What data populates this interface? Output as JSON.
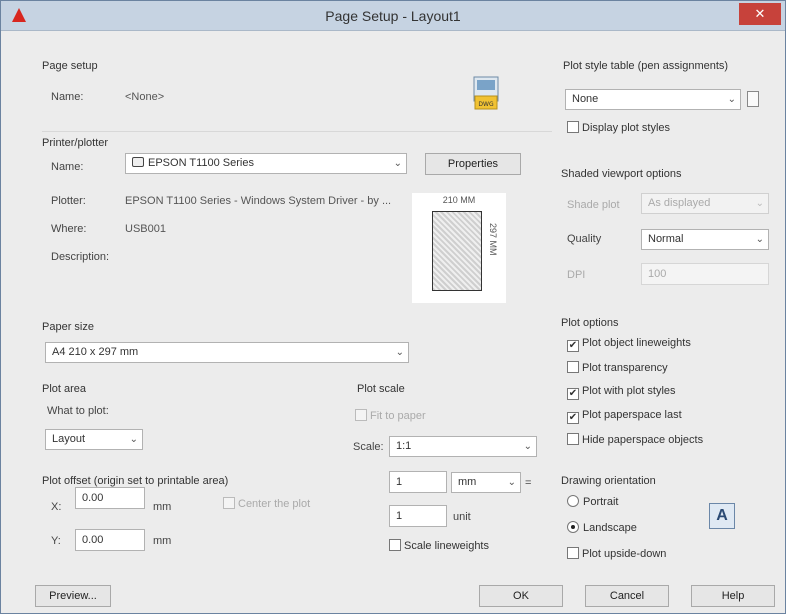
{
  "window": {
    "title": "Page Setup - Layout1",
    "close_glyph": "✕"
  },
  "page_setup": {
    "title": "Page setup",
    "name_label": "Name:",
    "name_value": "<None>"
  },
  "printer": {
    "title": "Printer/plotter",
    "name_label": "Name:",
    "name_value": "EPSON T1100 Series",
    "properties_button": "Properties",
    "plotter_label": "Plotter:",
    "plotter_value": "EPSON T1100 Series - Windows System Driver - by ...",
    "where_label": "Where:",
    "where_value": "USB001",
    "description_label": "Description:",
    "preview_width": "210 MM",
    "preview_height": "297 MM"
  },
  "paper_size": {
    "title": "Paper size",
    "value": "A4 210 x 297 mm"
  },
  "plot_area": {
    "title": "Plot area",
    "what_label": "What to plot:",
    "what_value": "Layout"
  },
  "plot_offset": {
    "title": "Plot offset (origin set to printable area)",
    "x_label": "X:",
    "x_value": "0.00",
    "x_unit": "mm",
    "y_label": "Y:",
    "y_value": "0.00",
    "y_unit": "mm",
    "center_label": "Center the plot"
  },
  "plot_scale": {
    "title": "Plot scale",
    "fit_label": "Fit to paper",
    "scale_label": "Scale:",
    "scale_value": "1:1",
    "num1": "1",
    "unit1": "mm",
    "equals": "=",
    "num2": "1",
    "unit2": "unit",
    "scale_lineweights_label": "Scale lineweights"
  },
  "plot_style_table": {
    "title": "Plot style table (pen assignments)",
    "value": "None",
    "display_label": "Display plot styles"
  },
  "shaded_viewport": {
    "title": "Shaded viewport options",
    "shade_plot_label": "Shade plot",
    "shade_plot_value": "As displayed",
    "quality_label": "Quality",
    "quality_value": "Normal",
    "dpi_label": "DPI",
    "dpi_value": "100"
  },
  "plot_options": {
    "title": "Plot options",
    "items": [
      {
        "label": "Plot object lineweights",
        "checked": true
      },
      {
        "label": "Plot transparency",
        "checked": false
      },
      {
        "label": "Plot with plot styles",
        "checked": true
      },
      {
        "label": "Plot paperspace last",
        "checked": true
      },
      {
        "label": "Hide paperspace objects",
        "checked": false
      }
    ]
  },
  "orientation": {
    "title": "Drawing orientation",
    "portrait": "Portrait",
    "landscape": "Landscape",
    "upside_down": "Plot upside-down",
    "selected": "landscape"
  },
  "buttons": {
    "preview": "Preview...",
    "ok": "OK",
    "cancel": "Cancel",
    "help": "Help"
  },
  "glyphs": {
    "dropdown": "⌄",
    "check": "✔"
  }
}
